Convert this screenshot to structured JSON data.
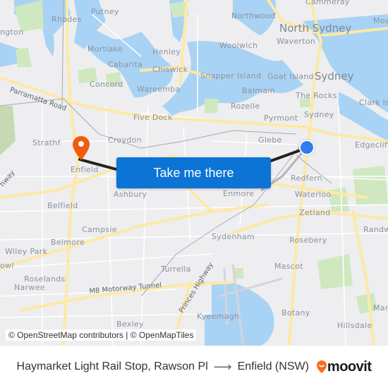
{
  "map": {
    "labels": [
      {
        "id": "putney",
        "text": "Putney"
      },
      {
        "id": "rhodes",
        "text": "Rhodes"
      },
      {
        "id": "ington",
        "text": "ngton"
      },
      {
        "id": "mortlake",
        "text": "Mortlake"
      },
      {
        "id": "henley",
        "text": "Henley"
      },
      {
        "id": "cabarita",
        "text": "Cabarita"
      },
      {
        "id": "chiswick",
        "text": "Chiswick"
      },
      {
        "id": "concord",
        "text": "Concord"
      },
      {
        "id": "wareemba",
        "text": "Wareemba"
      },
      {
        "id": "cammeray",
        "text": "Cammeray"
      },
      {
        "id": "northwood",
        "text": "Northwood"
      },
      {
        "id": "north-sydney",
        "text": "North Sydney"
      },
      {
        "id": "mos",
        "text": "Mos"
      },
      {
        "id": "waverton",
        "text": "Waverton"
      },
      {
        "id": "woolwich",
        "text": "Woolwich"
      },
      {
        "id": "snapper-island",
        "text": "Snapper Island"
      },
      {
        "id": "goat-island",
        "text": "Goat Island"
      },
      {
        "id": "sydney-big",
        "text": "Sydney"
      },
      {
        "id": "balmain",
        "text": "Balmain"
      },
      {
        "id": "the-rocks",
        "text": "The Rocks"
      },
      {
        "id": "clark-is",
        "text": "Clark Is"
      },
      {
        "id": "rozelle",
        "text": "Rozelle"
      },
      {
        "id": "five-dock",
        "text": "Five Dock"
      },
      {
        "id": "pyrmont",
        "text": "Pyrmont"
      },
      {
        "id": "sydney-small",
        "text": "Sydney"
      },
      {
        "id": "croydon",
        "text": "Croydon"
      },
      {
        "id": "strathf",
        "text": "Strathf"
      },
      {
        "id": "glebe",
        "text": "Glebe"
      },
      {
        "id": "edgecliff",
        "text": "Edgecliff"
      },
      {
        "id": "enfield",
        "text": "Enfield"
      },
      {
        "id": "ashbury",
        "text": "Ashbury"
      },
      {
        "id": "enmore",
        "text": "Enmore"
      },
      {
        "id": "redfern",
        "text": "Redfern"
      },
      {
        "id": "waterloo",
        "text": "Waterloo"
      },
      {
        "id": "belfield",
        "text": "Belfield"
      },
      {
        "id": "zetland",
        "text": "Zetland"
      },
      {
        "id": "campsie",
        "text": "Campsie"
      },
      {
        "id": "randw",
        "text": "Randw"
      },
      {
        "id": "belmore",
        "text": "Belmore"
      },
      {
        "id": "wiley-park",
        "text": "Wiley Park"
      },
      {
        "id": "sydenham",
        "text": "Sydenham"
      },
      {
        "id": "rosebery",
        "text": "Rosebery"
      },
      {
        "id": "owl",
        "text": "owl"
      },
      {
        "id": "turrella",
        "text": "Turrella"
      },
      {
        "id": "mascot",
        "text": "Mascot"
      },
      {
        "id": "roselands",
        "text": "Roselands"
      },
      {
        "id": "narwee",
        "text": "Narwee"
      },
      {
        "id": "kyeemagh",
        "text": "Kyeemagh"
      },
      {
        "id": "botany",
        "text": "Botany"
      },
      {
        "id": "mar",
        "text": "Mar"
      },
      {
        "id": "hillsdale",
        "text": "Hillsdale"
      },
      {
        "id": "bexley",
        "text": "Bexley"
      }
    ],
    "roads": {
      "parramatta_road": "Parramatta Road",
      "m8_tunnel": "M8 Motorway Tunnel",
      "princes_highway": "Princes Highway",
      "hway": "hway"
    },
    "origin_marker": "origin-dot",
    "destination_marker": "destination-pin",
    "colors": {
      "water": "#a9d3f5",
      "park": "#cfe8c0",
      "road": "#fde9a6",
      "route": "#222222",
      "origin": "#2f7df1",
      "destination": "#f25a0e"
    }
  },
  "attribution": "© OpenStreetMap contributors | © OpenMapTiles",
  "cta_button": "Take me there",
  "footer": {
    "origin": "Haymarket Light Rail Stop, Rawson Pl",
    "arrow": "⟶",
    "destination": "Enfield (NSW)",
    "brand": "moovit",
    "brand_color": "#f46d22"
  }
}
